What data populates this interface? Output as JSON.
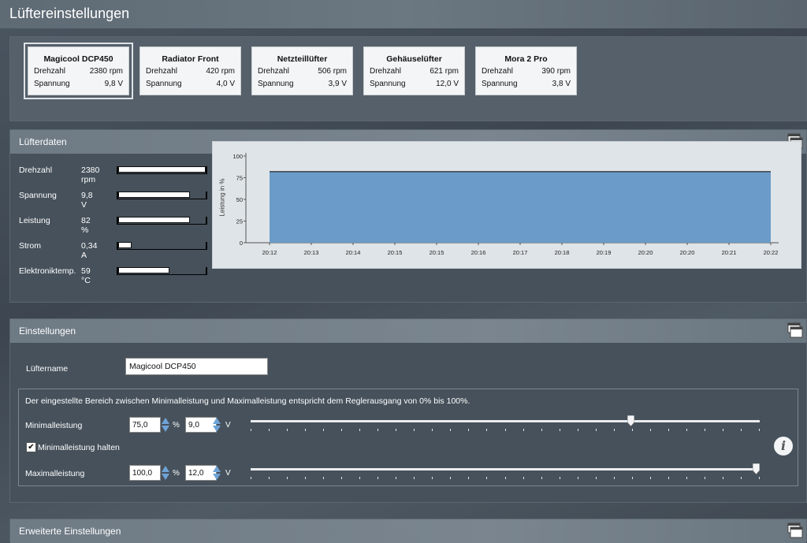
{
  "window": {
    "title": "Lüftereinstellungen"
  },
  "fans": [
    {
      "name": "Magicool DCP450",
      "speed_label": "Drehzahl",
      "speed": "2380 rpm",
      "voltage_label": "Spannung",
      "voltage": "9,8 V",
      "selected": true
    },
    {
      "name": "Radiator Front",
      "speed_label": "Drehzahl",
      "speed": "420 rpm",
      "voltage_label": "Spannung",
      "voltage": "4,0 V",
      "selected": false
    },
    {
      "name": "Netzteillüfter",
      "speed_label": "Drehzahl",
      "speed": "506 rpm",
      "voltage_label": "Spannung",
      "voltage": "3,9 V",
      "selected": false
    },
    {
      "name": "Gehäuselüfter",
      "speed_label": "Drehzahl",
      "speed": "621 rpm",
      "voltage_label": "Spannung",
      "voltage": "12,0 V",
      "selected": false
    },
    {
      "name": "Mora 2 Pro",
      "speed_label": "Drehzahl",
      "speed": "390 rpm",
      "voltage_label": "Spannung",
      "voltage": "3,8 V",
      "selected": false
    }
  ],
  "fan_data": {
    "title": "Lüfterdaten",
    "metrics": [
      {
        "label": "Drehzahl",
        "value": "2380 rpm",
        "level": 1.0
      },
      {
        "label": "Spannung",
        "value": "9,8 V",
        "level": 0.82
      },
      {
        "label": "Leistung",
        "value": "82 %",
        "level": 0.82
      },
      {
        "label": "Strom",
        "value": "0,34 A",
        "level": 0.15
      },
      {
        "label": "Elektroniktemp.",
        "value": "59 °C",
        "level": 0.59
      }
    ]
  },
  "chart_data": {
    "type": "area",
    "ylabel": "Leistung in %",
    "ylim": [
      0,
      100
    ],
    "yticks": [
      0,
      25,
      50,
      75,
      100
    ],
    "x": [
      "20:12",
      "20:13",
      "20:14",
      "20:15",
      "20:15",
      "20:16",
      "20:17",
      "20:18",
      "20:19",
      "20:20",
      "20:20",
      "20:21",
      "20:22"
    ],
    "series": [
      {
        "values": [
          82,
          82,
          82,
          82,
          82,
          82,
          82,
          82,
          82,
          82,
          82,
          82,
          82
        ]
      }
    ],
    "fill_color": "#6b9bc8",
    "line_color": "#1a1a1a",
    "grid": false
  },
  "settings": {
    "title": "Einstellungen",
    "name_label": "Lüftername",
    "name_value": "Magicool DCP450",
    "range_note": "Der eingestellte Bereich zwischen Minimalleistung und Maximalleistung entspricht dem Reglerausgang von 0% bis 100%.",
    "min_label": "Minimalleistung",
    "min_percent": "75,0",
    "min_volt": "9,0",
    "min_level": 0.75,
    "hold_min_label": "Minimalleistung halten",
    "hold_min_checked": true,
    "max_label": "Maximalleistung",
    "max_percent": "100,0",
    "max_volt": "12,0",
    "max_level": 1.0,
    "percent_unit": "%",
    "volt_unit": "V",
    "checkmark": "✔",
    "info_glyph": "i"
  },
  "advanced": {
    "title": "Erweiterte Einstellungen"
  },
  "icons": {
    "panel_toggle": "window-stack-icon",
    "info": "info-icon"
  }
}
